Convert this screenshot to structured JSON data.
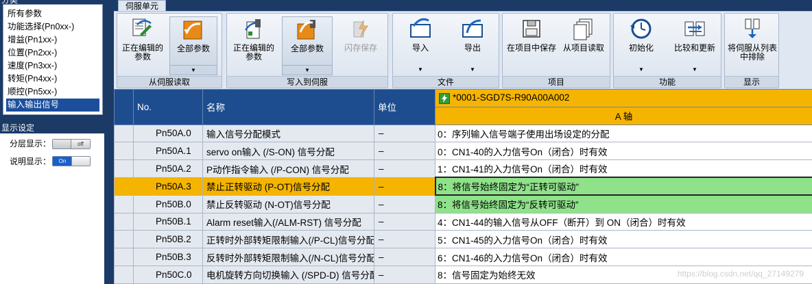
{
  "left": {
    "category_header": "分类",
    "categories": [
      "所有参数",
      "功能选择(Pn0xx-)",
      "增益(Pn1xx-)",
      "位置(Pn2xx-)",
      "速度(Pn3xx-)",
      "转矩(Pn4xx-)",
      "顺控(Pn5xx-)",
      "输入输出信号"
    ],
    "selected_category": "输入输出信号",
    "display_header": "显示设定",
    "layer_display_label": "分层显示：",
    "layer_display_state": "off",
    "desc_display_label": "说明显示：",
    "desc_display_state": "On"
  },
  "ribbon": {
    "tab": "伺服单元",
    "groups": {
      "read": {
        "label": "从伺服读取",
        "editing": "正在编辑的参数",
        "all": "全部参数"
      },
      "write": {
        "label": "写入到伺服",
        "editing": "正在编辑的参数",
        "all": "全部参数",
        "flash": "闪存保存"
      },
      "file": {
        "label": "文件",
        "import": "导入",
        "export": "导出"
      },
      "project": {
        "label": "项目",
        "save": "在项目中保存",
        "load": "从项目读取"
      },
      "function": {
        "label": "功能",
        "init": "初始化",
        "compare": "比较和更新"
      },
      "display": {
        "label": "显示",
        "exclude": "将伺服从列表中排除"
      }
    }
  },
  "table": {
    "headers": {
      "no": "No.",
      "name": "名称",
      "unit": "单位"
    },
    "device": "*0001-SGD7S-R90A00A002",
    "axis": "A 轴",
    "rows": [
      {
        "no": "Pn50A.0",
        "name": "输入信号分配模式",
        "unit": "–",
        "value": "0：序列输入信号端子使用出场设定的分配"
      },
      {
        "no": "Pn50A.1",
        "name": "servo on输入 (/S-ON) 信号分配",
        "unit": "–",
        "value": "0：CN1-40的入力信号On（闭合）时有效"
      },
      {
        "no": "Pn50A.2",
        "name": "P动作指令输入 (/P-CON) 信号分配",
        "unit": "–",
        "value": "1：CN1-41的入力信号On（闭合）时有效"
      },
      {
        "no": "Pn50A.3",
        "name": "禁止正转驱动 (P-OT)信号分配",
        "unit": "–",
        "value": "8：将信号始终固定为“正转可驱动”"
      },
      {
        "no": "Pn50B.0",
        "name": "禁止反转驱动 (N-OT)信号分配",
        "unit": "–",
        "value": "8：将信号始终固定为“反转可驱动”"
      },
      {
        "no": "Pn50B.1",
        "name": "Alarm reset输入(/ALM-RST) 信号分配",
        "unit": "–",
        "value": "4：CN1-44的输入信号从OFF（断开）到 ON（闭合）时有效"
      },
      {
        "no": "Pn50B.2",
        "name": "正转时外部转矩限制输入(/P-CL)信号分配",
        "unit": "–",
        "value": "5：CN1-45的入力信号On（闭合）时有效"
      },
      {
        "no": "Pn50B.3",
        "name": "反转时外部转矩限制输入(/N-CL)信号分配",
        "unit": "–",
        "value": "6：CN1-46的入力信号On（闭合）时有效"
      },
      {
        "no": "Pn50C.0",
        "name": "电机旋转方向切换输入 (/SPD-D) 信号分配",
        "unit": "–",
        "value": "8：信号固定为始终无效"
      }
    ]
  },
  "watermark": "https://blog.csdn.net/qq_27149279",
  "colors": {
    "accent": "#f5b400",
    "header_blue": "#1d4d8f",
    "green_cell": "#8fe28a",
    "selected_category": "#1b4f9c"
  }
}
